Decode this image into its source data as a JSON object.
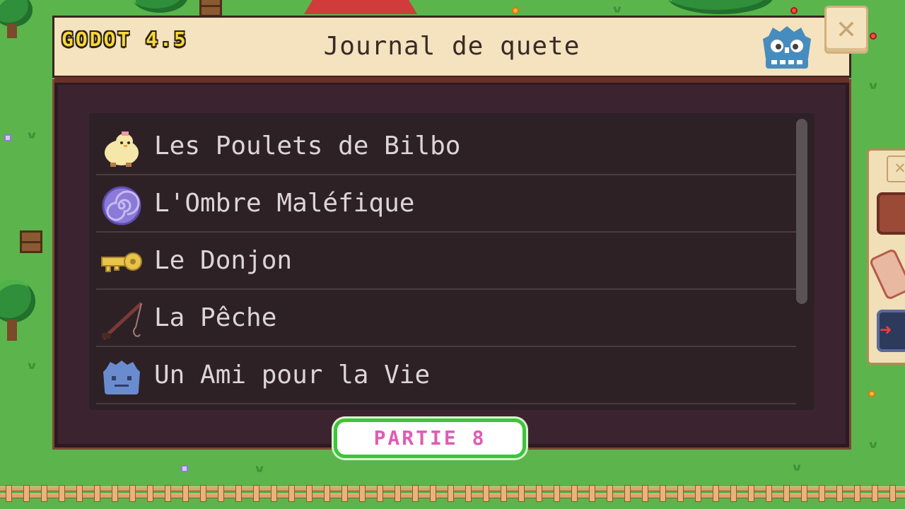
{
  "header": {
    "engine_label": "GODOT 4.5",
    "title": "Journal de quete",
    "close_glyph": "✕"
  },
  "quests": [
    {
      "label": "Les Poulets de Bilbo",
      "icon": "chick-icon"
    },
    {
      "label": "L'Ombre Maléfique",
      "icon": "spiral-orb-icon"
    },
    {
      "label": "Le Donjon",
      "icon": "golden-key-icon"
    },
    {
      "label": "La Pêche",
      "icon": "fishing-rod-icon"
    },
    {
      "label": "Un Ami pour la Vie",
      "icon": "godot-friend-icon"
    }
  ],
  "badge": {
    "label": "PARTIE 8"
  },
  "colors": {
    "grass": "#5cb44c",
    "header_bg": "#f4e3be",
    "window_bg": "#3c2330",
    "list_bg": "#2d2126",
    "text": "#dcd5d8",
    "engine_label": "#f7d83b",
    "badge_text": "#e05cb4",
    "badge_border": "#3ec43a"
  }
}
